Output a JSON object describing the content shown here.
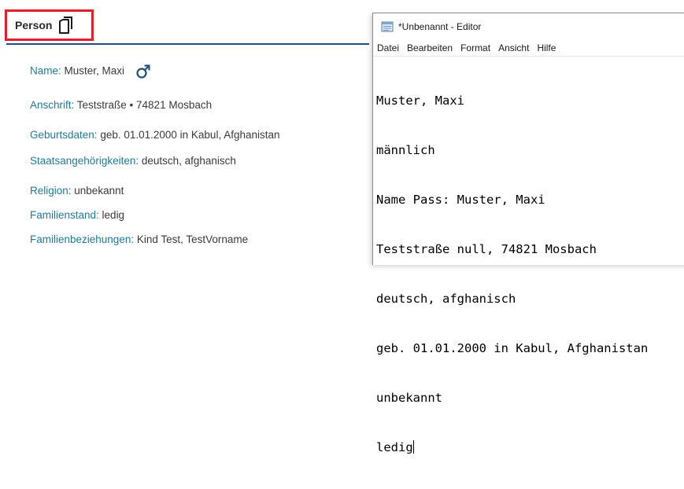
{
  "person_card": {
    "title": "Person",
    "fields": [
      {
        "label": "Name:",
        "value": " Muster, Maxi"
      },
      {
        "label": "Anschrift:",
        "value": " Teststraße • 74821 Mosbach"
      },
      {
        "label": "Geburtsdaten:",
        "value": " geb. 01.01.2000 in Kabul, Afghanistan"
      },
      {
        "label": "Staatsangehörigkeiten:",
        "value": " deutsch, afghanisch"
      },
      {
        "label": "Religion:",
        "value": " unbekannt"
      },
      {
        "label": "Familienstand:",
        "value": " ledig"
      },
      {
        "label": "Familienbeziehungen:",
        "value": " Kind Test, TestVorname"
      }
    ],
    "icons": {
      "copy": "copy-icon",
      "gender": "male-icon"
    },
    "colors": {
      "highlight_border": "#e1202c",
      "label": "#1f7a9c",
      "rule": "#1f4f7a"
    }
  },
  "notepad": {
    "title": "*Unbenannt - Editor",
    "menu": [
      "Datei",
      "Bearbeiten",
      "Format",
      "Ansicht",
      "Hilfe"
    ],
    "lines": [
      "Muster, Maxi",
      "männlich",
      "Name Pass: Muster, Maxi",
      "Teststraße null, 74821 Mosbach",
      "deutsch, afghanisch",
      "geb. 01.01.2000 in Kabul, Afghanistan",
      "unbekannt",
      "ledig"
    ]
  }
}
